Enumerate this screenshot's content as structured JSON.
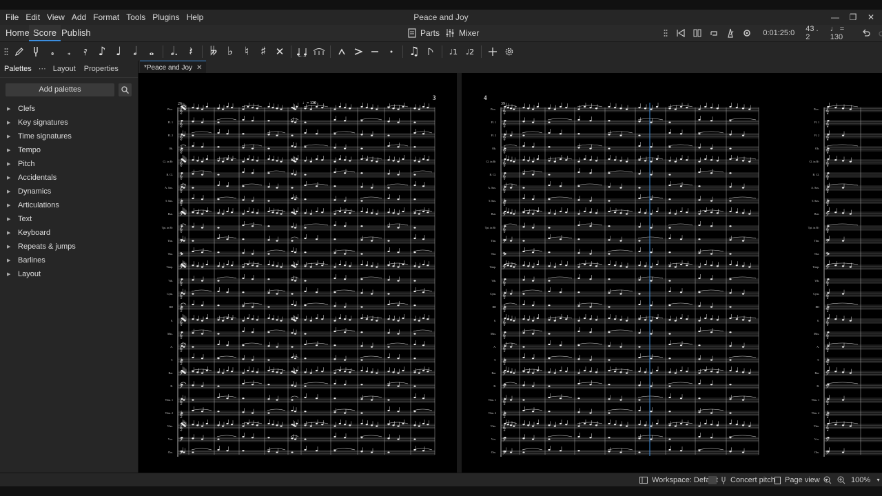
{
  "window": {
    "title": "Peace and Joy"
  },
  "menu": [
    "File",
    "Edit",
    "View",
    "Add",
    "Format",
    "Tools",
    "Plugins",
    "Help"
  ],
  "top_tabs": [
    "Home",
    "Score",
    "Publish"
  ],
  "toolbar_center": {
    "parts": "Parts",
    "mixer": "Mixer"
  },
  "playback": {
    "time": "0:01:25:0",
    "position": "43 . 2",
    "tempo": "♩ = 130"
  },
  "note_toolbar": [
    "pencil-icon",
    "tuning-fork-icon",
    "note-64th",
    "note-32nd",
    "note-16th",
    "note-8th",
    "note-quarter",
    "note-half",
    "note-whole",
    "dotted-note",
    "rest",
    "double-flat",
    "flat",
    "natural",
    "sharp",
    "double-sharp",
    "tie",
    "slur",
    "marcato",
    "accent",
    "tenuto",
    "staccato",
    "tuplet",
    "flip",
    "voice-1",
    "voice-2",
    "add",
    "settings"
  ],
  "left_panel": {
    "tabs": [
      "Palettes",
      "Layout",
      "Properties"
    ],
    "add_palettes": "Add palettes",
    "palettes": [
      "Clefs",
      "Key signatures",
      "Time signatures",
      "Tempo",
      "Pitch",
      "Accidentals",
      "Dynamics",
      "Articulations",
      "Text",
      "Keyboard",
      "Repeats & jumps",
      "Barlines",
      "Layout"
    ]
  },
  "document_tab": {
    "label": "*Peace and Joy"
  },
  "score": {
    "page1": {
      "page_number": "3",
      "measure_number": "26",
      "tempo_marking": "♩= 130"
    },
    "page2": {
      "page_number": "4",
      "measure_number": "39"
    },
    "instruments": [
      "Picc.",
      "Fl. 1",
      "Fl. 2",
      "Ob.",
      "Cl. in B♭",
      "B. Cl.",
      "A. Sax.",
      "T. Sax.",
      "Bsn.",
      "Tpt. in B♭",
      "Tbn.",
      "Tba.",
      "Timp.",
      "Vib.",
      "Cym.",
      "BD",
      "S.",
      "Mzs.",
      "A.",
      "T.",
      "Bar.",
      "B.",
      "Vlns. 1",
      "Vlns. 2",
      "Vlas.",
      "Vcs.",
      "Cbs."
    ]
  },
  "status": {
    "workspace": "Workspace: Default",
    "concert_pitch": "Concert pitch",
    "view": "Page view",
    "zoom": "100%"
  },
  "colors": {
    "accent": "#3d8fe0",
    "canvas": "#000000",
    "panel": "#262626"
  }
}
